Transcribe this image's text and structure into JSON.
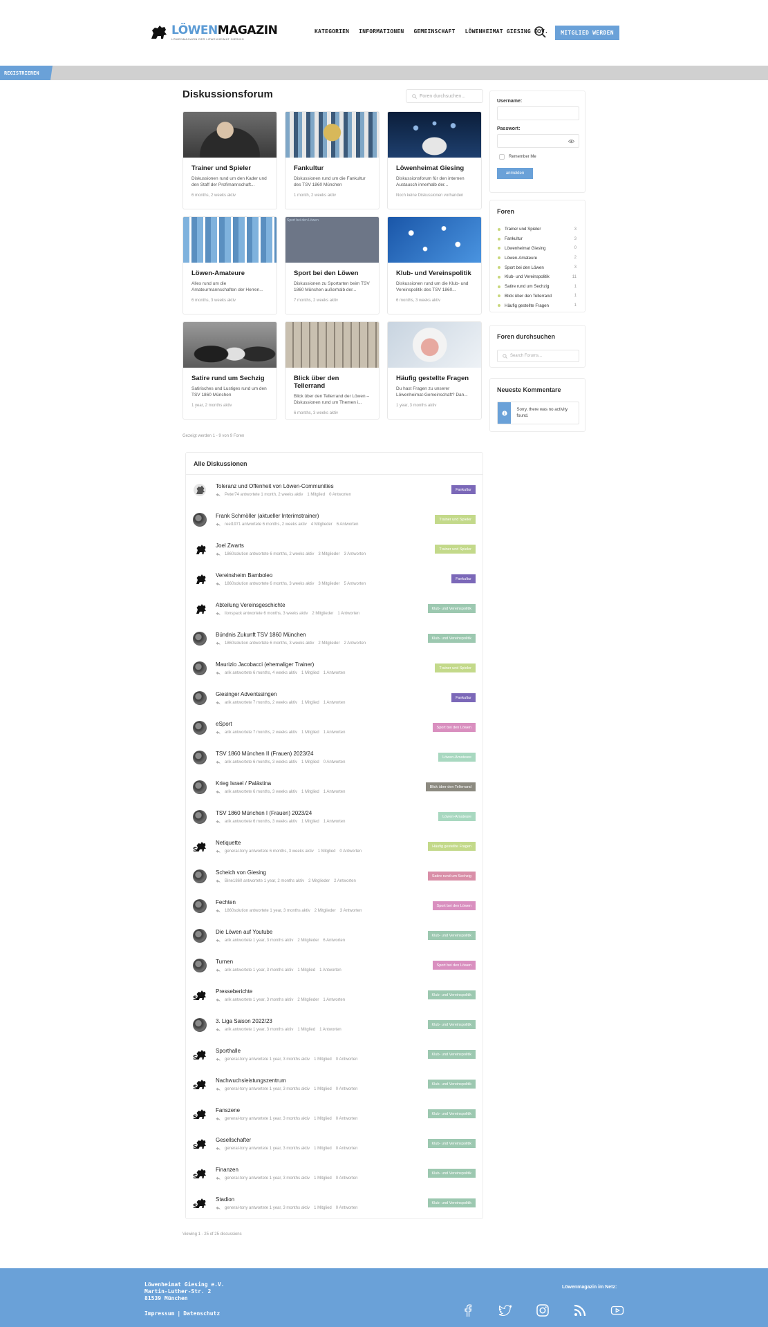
{
  "header": {
    "logo_part1": "LÖWEN",
    "logo_part2": "MAGAZIN",
    "logo_tagline": "LÖWENMAGAZIN DER LÖWENHEIMAT GIESING",
    "nav": [
      "KATEGORIEN",
      "INFORMATIONEN",
      "GEMEINSCHAFT",
      "LÖWENHEIMAT GIESING E.V."
    ],
    "member_button": "MITGLIED WERDEN"
  },
  "register_tab": "REGISTRIEREN",
  "main": {
    "title": "Diskussionsforum",
    "search_placeholder": "Foren durchsuchen...",
    "showing": "Gezeigt werden 1 - 9 von 9 Foren",
    "viewing": "Viewing 1 - 25 of 25 discussions"
  },
  "cards": [
    {
      "title": "Trainer und Spieler",
      "desc": "Diskussionen rund um den Kader und den Staff der Profimannschaft...",
      "meta": "6 months, 2 weeks aktiv",
      "img": "coach"
    },
    {
      "title": "Fankultur",
      "desc": "Diskussionen rund um die Fankultur des TSV 1860 München",
      "meta": "1 month, 2 weeks aktiv",
      "img": "fans"
    },
    {
      "title": "Löwenheimat Giesing",
      "desc": "Diskussionsforum für den internen Austausch innerhalb der...",
      "meta": "Noch keine Diskussionen vorhanden",
      "img": "network-hand"
    },
    {
      "title": "Löwen-Amateure",
      "desc": "Alles rund um die Amateurmannschaften der Herren...",
      "meta": "6 months, 3 weeks aktiv",
      "img": "team"
    },
    {
      "title": "Sport bei den Löwen",
      "desc": "Diskussionen zu Sportarten beim TSV 1860 München außerhalb der...",
      "meta": "7 months, 2 weeks aktiv",
      "img": "blank",
      "img_label": "Sport bei den Löwen"
    },
    {
      "title": "Klub- und Vereinspolitik",
      "desc": "Diskussionen rund um die Klub- und Vereinspolitik des TSV 1860...",
      "meta": "6 months, 3 weeks aktiv",
      "img": "network-blue"
    },
    {
      "title": "Satire rund um Sechzig",
      "desc": "Satirisches und Lustiges rund um den TSV 1860 München",
      "meta": "1 year, 2 months aktiv",
      "img": "celebration"
    },
    {
      "title": "Blick über den Tellerrand",
      "desc": "Blick über den Tellerrand der Löwen – Diskussionen rund um Themen i...",
      "meta": "6 months, 3 weeks aktiv",
      "img": "street"
    },
    {
      "title": "Häufig gestellte Fragen",
      "desc": "Du hast Fragen zu unserer Löwenheimat-Gemeinschaft? Dan...",
      "meta": "1 year, 3 months aktiv",
      "img": "bulb"
    }
  ],
  "discussions": {
    "header": "Alle Diskussionen",
    "rows": [
      {
        "title": "Toleranz und Offenheit von Löwen-Communities",
        "meta": "Peter74 antwortete 1 month, 2 weeks aktiv",
        "members": "1 Mitglied",
        "replies": "0 Antworten",
        "tag": "Fankultur",
        "color": "#7b68b8",
        "avatar": "lion-grey"
      },
      {
        "title": "Frank Schmöller (aktueller Interimstrainer)",
        "meta": "reel1971 antwortete 6 months, 2 weeks aktiv",
        "members": "4 Mitglieder",
        "replies": "6 Antworten",
        "tag": "Trainer und Spieler",
        "color": "#c3d98a",
        "avatar": "photo"
      },
      {
        "title": "Joel Zwarts",
        "meta": "1860solution antwortete 6 months, 2 weeks aktiv",
        "members": "3 Mitglieder",
        "replies": "3 Antworten",
        "tag": "Trainer und Spieler",
        "color": "#c3d98a",
        "avatar": "lion"
      },
      {
        "title": "Vereinsheim Bamboleo",
        "meta": "1860solution antwortete 6 months, 3 weeks aktiv",
        "members": "3 Mitglieder",
        "replies": "5 Antworten",
        "tag": "Fankultur",
        "color": "#7b68b8",
        "avatar": "lion"
      },
      {
        "title": "Abteilung Vereinsgeschichte",
        "meta": "lionspack antwortete 6 months, 3 weeks aktiv",
        "members": "2 Mitglieder",
        "replies": "1 Antworten",
        "tag": "Klub- und Vereinspolitik",
        "color": "#9cc8b0",
        "avatar": "lion"
      },
      {
        "title": "Bündnis Zukunft TSV 1860 München",
        "meta": "1860solution antwortete 6 months, 3 weeks aktiv",
        "members": "2 Mitglieder",
        "replies": "2 Antworten",
        "tag": "Klub- und Vereinspolitik",
        "color": "#9cc8b0",
        "avatar": "photo"
      },
      {
        "title": "Maurizio Jacobacci (ehemaliger Trainer)",
        "meta": "arik antwortete 6 months, 4 weeks aktiv",
        "members": "1 Mitglied",
        "replies": "1 Antworten",
        "tag": "Trainer und Spieler",
        "color": "#c3d98a",
        "avatar": "photo"
      },
      {
        "title": "Giesinger Adventssingen",
        "meta": "arik antwortete 7 months, 2 weeks aktiv",
        "members": "1 Mitglied",
        "replies": "1 Antworten",
        "tag": "Fankultur",
        "color": "#7b68b8",
        "avatar": "photo"
      },
      {
        "title": "eSport",
        "meta": "arik antwortete 7 months, 2 weeks aktiv",
        "members": "1 Mitglied",
        "replies": "1 Antworten",
        "tag": "Sport bei den Löwen",
        "color": "#d98fbf",
        "avatar": "photo"
      },
      {
        "title": "TSV 1860 München II (Frauen) 2023/24",
        "meta": "arik antwortete 6 months, 3 weeks aktiv",
        "members": "1 Mitglied",
        "replies": "0 Antworten",
        "tag": "Löwen-Amateure",
        "color": "#a8d8c0",
        "avatar": "photo"
      },
      {
        "title": "Krieg Israel / Palästina",
        "meta": "arik antwortete 6 months, 3 weeks aktiv",
        "members": "1 Mitglied",
        "replies": "1 Antworten",
        "tag": "Blick über den Tellerrand",
        "color": "#8c8a80",
        "avatar": "photo"
      },
      {
        "title": "TSV 1860 München I (Frauen) 2023/24",
        "meta": "arik antwortete 6 months, 3 weeks aktiv",
        "members": "1 Mitglied",
        "replies": "1 Antworten",
        "tag": "Löwen-Amateure",
        "color": "#a8d8c0",
        "avatar": "photo"
      },
      {
        "title": "Netiquette",
        "meta": "general-tony antwortete 6 months, 3 weeks aktiv",
        "members": "1 Mitglied",
        "replies": "0 Antworten",
        "tag": "Häufig gestellte Fragen",
        "color": "#c3d98a",
        "avatar": "lion-s"
      },
      {
        "title": "Scheich von Giesing",
        "meta": "Bine1860 antwortete 1 year, 2 months aktiv",
        "members": "2 Mitglieder",
        "replies": "2 Antworten",
        "tag": "Satire rund um Sechzig",
        "color": "#d98fa8",
        "avatar": "photo"
      },
      {
        "title": "Fechten",
        "meta": "1860solution antwortete 1 year, 3 months aktiv",
        "members": "2 Mitglieder",
        "replies": "3 Antworten",
        "tag": "Sport bei den Löwen",
        "color": "#d98fbf",
        "avatar": "photo"
      },
      {
        "title": "Die Löwen auf Youtube",
        "meta": "arik antwortete 1 year, 3 months aktiv",
        "members": "2 Mitglieder",
        "replies": "6 Antworten",
        "tag": "Klub- und Vereinspolitik",
        "color": "#9cc8b0",
        "avatar": "photo"
      },
      {
        "title": "Turnen",
        "meta": "arik antwortete 1 year, 3 months aktiv",
        "members": "1 Mitglied",
        "replies": "1 Antworten",
        "tag": "Sport bei den Löwen",
        "color": "#d98fbf",
        "avatar": "photo"
      },
      {
        "title": "Presseberichte",
        "meta": "arik antwortete 1 year, 3 months aktiv",
        "members": "2 Mitglieder",
        "replies": "1 Antworten",
        "tag": "Klub- und Vereinspolitik",
        "color": "#9cc8b0",
        "avatar": "lion-s"
      },
      {
        "title": "3. Liga Saison 2022/23",
        "meta": "arik antwortete 1 year, 3 months aktiv",
        "members": "1 Mitglied",
        "replies": "1 Antworten",
        "tag": "Klub- und Vereinspolitik",
        "color": "#9cc8b0",
        "avatar": "photo"
      },
      {
        "title": "Sporthalle",
        "meta": "general-tony antwortete 1 year, 3 months aktiv",
        "members": "1 Mitglied",
        "replies": "0 Antworten",
        "tag": "Klub- und Vereinspolitik",
        "color": "#9cc8b0",
        "avatar": "lion-s"
      },
      {
        "title": "Nachwuchsleistungszentrum",
        "meta": "general-tony antwortete 1 year, 3 months aktiv",
        "members": "1 Mitglied",
        "replies": "0 Antworten",
        "tag": "Klub- und Vereinspolitik",
        "color": "#9cc8b0",
        "avatar": "lion-s"
      },
      {
        "title": "Fanszene",
        "meta": "general-tony antwortete 1 year, 3 months aktiv",
        "members": "1 Mitglied",
        "replies": "0 Antworten",
        "tag": "Klub- und Vereinspolitik",
        "color": "#9cc8b0",
        "avatar": "lion-s"
      },
      {
        "title": "Gesellschafter",
        "meta": "general-tony antwortete 1 year, 3 months aktiv",
        "members": "1 Mitglied",
        "replies": "0 Antworten",
        "tag": "Klub- und Vereinspolitik",
        "color": "#9cc8b0",
        "avatar": "lion-s"
      },
      {
        "title": "Finanzen",
        "meta": "general-tony antwortete 1 year, 3 months aktiv",
        "members": "1 Mitglied",
        "replies": "0 Antworten",
        "tag": "Klub- und Vereinspolitik",
        "color": "#9cc8b0",
        "avatar": "lion-s"
      },
      {
        "title": "Stadion",
        "meta": "general-tony antwortete 1 year, 3 months aktiv",
        "members": "1 Mitglied",
        "replies": "0 Antworten",
        "tag": "Klub- und Vereinspolitik",
        "color": "#9cc8b0",
        "avatar": "lion-s"
      }
    ]
  },
  "sidebar": {
    "login": {
      "username_label": "Username:",
      "password_label": "Passwort:",
      "remember": "Remember Me",
      "button": "anmelden"
    },
    "foren": {
      "title": "Foren",
      "items": [
        {
          "label": "Trainer und Spieler",
          "count": "3"
        },
        {
          "label": "Fankultur",
          "count": "3"
        },
        {
          "label": "Löwenheimat Giesing",
          "count": "0"
        },
        {
          "label": "Löwen-Amateure",
          "count": "2"
        },
        {
          "label": "Sport bei den Löwen",
          "count": "3"
        },
        {
          "label": "Klub- und Vereinspolitik",
          "count": "11"
        },
        {
          "label": "Satire rund um Sechzig",
          "count": "1"
        },
        {
          "label": "Blick über den Tellerrand",
          "count": "1"
        },
        {
          "label": "Häufig gestellte Fragen",
          "count": "1"
        }
      ]
    },
    "search": {
      "title": "Foren durchsuchen",
      "placeholder": "Search Forums..."
    },
    "comments": {
      "title": "Neueste Kommentare",
      "notice": "Sorry, there was no activity found."
    }
  },
  "footer": {
    "addr1": "Löwenheimat Giesing e.V.",
    "addr2": "Martin-Luther-Str. 2",
    "addr3": "81539 München",
    "impressum": "Impressum",
    "separator": "|",
    "datenschutz": "Datenschutz",
    "net": "Löwenmagazin im Netz:"
  },
  "colors": {
    "accent": "#6aa1d8"
  }
}
